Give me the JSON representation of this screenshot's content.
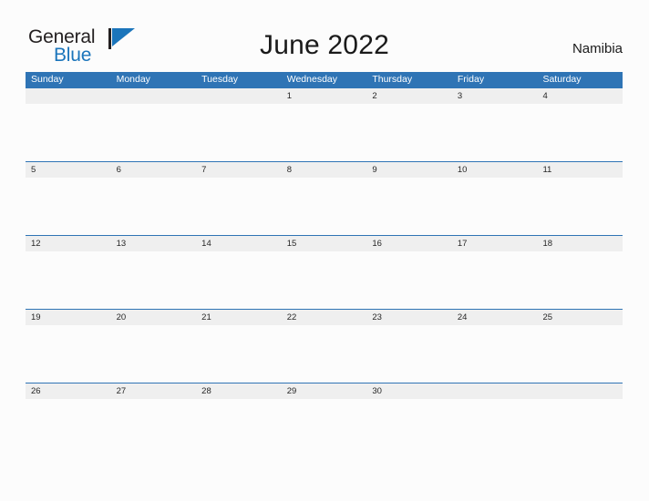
{
  "header": {
    "logo": {
      "word_one": "General",
      "word_two": "Blue",
      "flag_icon": "blue-triangle-flag-icon",
      "color_black": "#231f20",
      "color_blue": "#1b75bb"
    },
    "title": "June 2022",
    "locale": "Namibia"
  },
  "calendar": {
    "accent_color": "#2f74b5",
    "band_color": "#efefef",
    "weekday_headers": [
      "Sunday",
      "Monday",
      "Tuesday",
      "Wednesday",
      "Thursday",
      "Friday",
      "Saturday"
    ],
    "weeks": [
      [
        "",
        "",
        "",
        "1",
        "2",
        "3",
        "4"
      ],
      [
        "5",
        "6",
        "7",
        "8",
        "9",
        "10",
        "11"
      ],
      [
        "12",
        "13",
        "14",
        "15",
        "16",
        "17",
        "18"
      ],
      [
        "19",
        "20",
        "21",
        "22",
        "23",
        "24",
        "25"
      ],
      [
        "26",
        "27",
        "28",
        "29",
        "30",
        "",
        ""
      ]
    ]
  }
}
